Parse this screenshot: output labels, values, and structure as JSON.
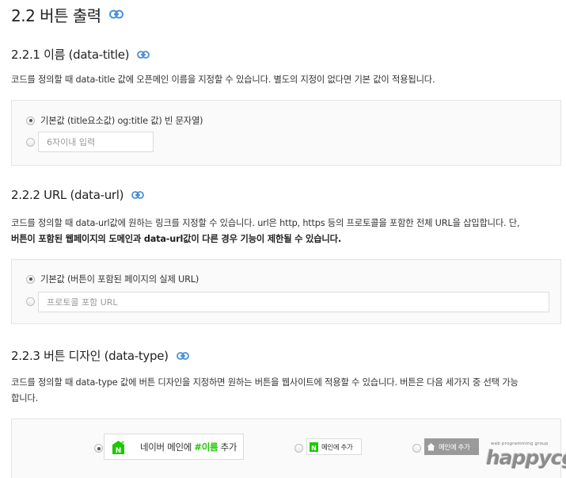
{
  "section": {
    "title": "2.2 버튼 출력",
    "icon": "link-icon"
  },
  "name": {
    "title": "2.2.1 이름 (data-title)",
    "desc": "코드를 정의할 때 data-title 값에 오픈메인 이름을 지정할 수 있습니다. 별도의 지정이 없다면 기본 값이 적용됩니다.",
    "option_default": "기본값 (title요소값) og:title 값) 빈 문자열)",
    "input_placeholder": "6자이내 입력"
  },
  "url": {
    "title": "2.2.2 URL (data-url)",
    "desc": "코드를 정의할 때 data-url값에 원하는 링크를 지정할 수 있습니다. url은 http, https 등의 프로토콜을 포함한 전체 URL을 삽입합니다. 단,",
    "desc_bold": "버튼이 포함된 웹페이지의 도메인과 data-url값이 다른 경우 기능이 제한될 수 있습니다.",
    "option_default": "기본값 (버튼이 포함된 페이지의 실제 URL)",
    "input_placeholder": "프로토콜 포함 URL"
  },
  "type": {
    "title": "2.2.3 버튼 디자인 (data-type)",
    "desc_line1": "코드를 정의할 때 data-type 값에 버튼 디자인을 지정하면 원하는 버튼을 웹사이트에 적용할 수 있습니다. 버튼은 다음 세가지 중 선택 가능",
    "desc_line2": "합니다.",
    "btn_big_prefix": "네이버 메인에 ",
    "btn_big_green": "#이름",
    "btn_big_suffix": " 추가",
    "btn_small": "메인에 추가",
    "btn_gray": "메인에 추가"
  },
  "watermark": {
    "tiny": "web programming group",
    "big": "happycgi"
  },
  "colors": {
    "naver_green": "#1ec800",
    "link_blue": "#4a90d9",
    "box_bg": "#fafafa",
    "gray_button": "#9a9a9a"
  }
}
